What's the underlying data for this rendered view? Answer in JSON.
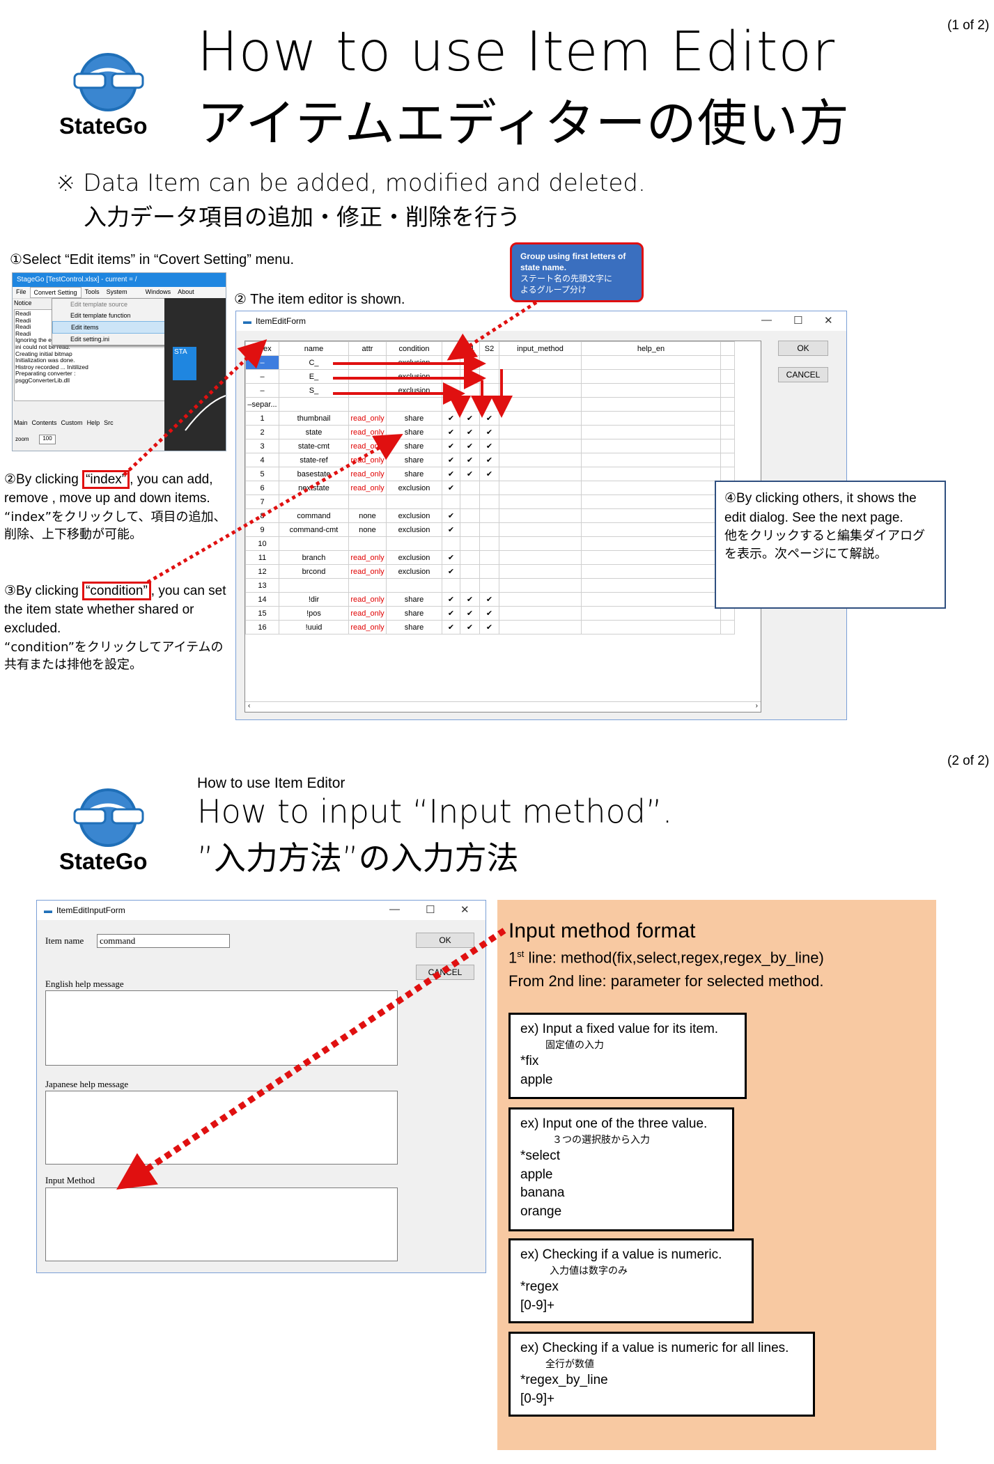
{
  "page1": {
    "page_number": "(1 of 2)",
    "logo_text": "StateGo",
    "title_en": "How to use Item Editor",
    "title_jp": "アイテムエディターの使い方",
    "note_en": "※ Data Item can be added, modified and deleted.",
    "note_jp": "入力データ項目の追加・修正・削除を行う",
    "step1": "①Select “Edit items” in “Covert Setting” menu.",
    "step2": "② The item editor is shown.",
    "group_callout": [
      "Group using  first letters of state name.",
      "ステート名の先頭文字に",
      "よるグループ分け"
    ],
    "step2b": {
      "before": "②By clicking ",
      "highlight": "“index”",
      "after": ", you can add, remove , move up and down items.",
      "jp": "“index”をクリックして、項目の追加、削除、上下移動が可能。"
    },
    "step3": {
      "before": "③By clicking ",
      "highlight": "“condition”",
      "after": ", you can set the item state whether shared or excluded.",
      "jp": "“condition”をクリックしてアイテムの共有または排他を設定。"
    },
    "step4": {
      "en": "④By clicking others, it shows the edit dialog. See the next page.",
      "jp": "他をクリックすると編集ダイアログを表示。次ページにて解説。"
    }
  },
  "app_window": {
    "title": "StageGo  [TestControl.xlsx] - current = /",
    "menu": [
      "File",
      "Convert Setting",
      "Tools",
      "System",
      "Windows",
      "About"
    ],
    "dropdown": [
      "Edit template source",
      "Edit template function",
      "Edit items",
      "Edit setting.ini"
    ],
    "notice_label": "Notice",
    "log_lines": [
      "Readi",
      "Readi",
      "Readi",
      "Readi",
      "Ignoring the error state_function_list.m",
      "ini could not be read.",
      "Creating initial bitmap",
      "Initialization was done.",
      "Histroy recorded ... Initilized",
      "Preparating converter :",
      "psggConverterLib.dll"
    ],
    "tabs": [
      "Main",
      "Contents",
      "Custom",
      "Help",
      "Src"
    ],
    "zoom_label": "zoom",
    "zoom_value": "100",
    "node_text": "STA"
  },
  "item_edit_form": {
    "title": "ItemEditForm",
    "ok": "OK",
    "cancel": "CANCEL",
    "columns": [
      "index",
      "name",
      "attr",
      "condition",
      "",
      "S1",
      "S2",
      "input_method",
      "help_en"
    ],
    "rows": [
      [
        "–",
        "C_",
        "",
        "exclusion",
        "",
        "✔",
        "",
        "",
        ""
      ],
      [
        "–",
        "E_",
        "",
        "exclusion",
        "",
        "✔",
        "",
        "",
        ""
      ],
      [
        "–",
        "S_",
        "",
        "exclusion",
        "✔",
        "",
        "",
        "",
        ""
      ],
      [
        "–separ...",
        "",
        "",
        "",
        "",
        "",
        "",
        "",
        ""
      ],
      [
        "1",
        "thumbnail",
        "read_only",
        "share",
        "✔",
        "✔",
        "✔",
        "",
        ""
      ],
      [
        "2",
        "state",
        "read_only",
        "share",
        "✔",
        "✔",
        "✔",
        "",
        ""
      ],
      [
        "3",
        "state-cmt",
        "read_only",
        "share",
        "✔",
        "✔",
        "✔",
        "",
        ""
      ],
      [
        "4",
        "state-ref",
        "read_only",
        "share",
        "✔",
        "✔",
        "✔",
        "",
        ""
      ],
      [
        "5",
        "basestate",
        "read_only",
        "share",
        "✔",
        "✔",
        "✔",
        "",
        ""
      ],
      [
        "6",
        "nextstate",
        "read_only",
        "exclusion",
        "✔",
        "",
        "",
        "",
        ""
      ],
      [
        "7",
        "",
        "",
        "",
        "",
        "",
        "",
        "",
        ""
      ],
      [
        "8",
        "command",
        "none",
        "exclusion",
        "✔",
        "",
        "",
        "",
        ""
      ],
      [
        "9",
        "command-cmt",
        "none",
        "exclusion",
        "✔",
        "",
        "",
        "",
        ""
      ],
      [
        "10",
        "",
        "",
        "",
        "",
        "",
        "",
        "",
        ""
      ],
      [
        "11",
        "branch",
        "read_only",
        "exclusion",
        "✔",
        "",
        "",
        "",
        ""
      ],
      [
        "12",
        "brcond",
        "read_only",
        "exclusion",
        "✔",
        "",
        "",
        "",
        ""
      ],
      [
        "13",
        "",
        "",
        "",
        "",
        "",
        "",
        "",
        ""
      ],
      [
        "14",
        "!dir",
        "read_only",
        "share",
        "✔",
        "✔",
        "✔",
        "",
        ""
      ],
      [
        "15",
        "!pos",
        "read_only",
        "share",
        "✔",
        "✔",
        "✔",
        "",
        ""
      ],
      [
        "16",
        "!uuid",
        "read_only",
        "share",
        "✔",
        "✔",
        "✔",
        "",
        ""
      ]
    ]
  },
  "page2": {
    "page_number": "(2 of 2)",
    "logo_text": "StateGo",
    "subtitle": "How to use Item Editor",
    "title_en": "How to input “Input method”.",
    "title_jp": "”入力方法”の入力方法"
  },
  "input_form": {
    "title": "ItemEditInputForm",
    "item_name_label": "Item name",
    "item_name_value": "command",
    "ok": "OK",
    "cancel": "CANCEL",
    "english_help_label": "English help message",
    "japanese_help_label": "Japanese help message",
    "input_method_label": "Input Method"
  },
  "format_panel": {
    "heading": "Input method format",
    "line1_prefix": "1",
    "line1_sup": "st",
    "line1_rest": " line: method(fix,select,regex,regex_by_line)",
    "line2": "From 2nd line: parameter for selected method.",
    "examples": [
      {
        "title": "ex) Input a fixed value for its item.",
        "jp": "固定値の入力",
        "lines": [
          "*fix",
          "apple"
        ]
      },
      {
        "title": "ex) Input one of the three value.",
        "jp": "３つの選択肢から入力",
        "lines": [
          "*select",
          "apple",
          "banana",
          "orange"
        ]
      },
      {
        "title": "ex) Checking if a value is numeric.",
        "jp": "入力値は数字のみ",
        "lines": [
          "*regex",
          "[0-9]+"
        ]
      },
      {
        "title": "ex) Checking if a value is numeric for all lines.",
        "jp": "全行が数値",
        "lines": [
          "*regex_by_line",
          "[0-9]+"
        ]
      }
    ]
  },
  "colors": {
    "accent_red": "#e01010",
    "panel_bg": "#f8c9a2",
    "logo_blue": "#1f6fb8",
    "callout_blue": "#3a6fbf"
  }
}
